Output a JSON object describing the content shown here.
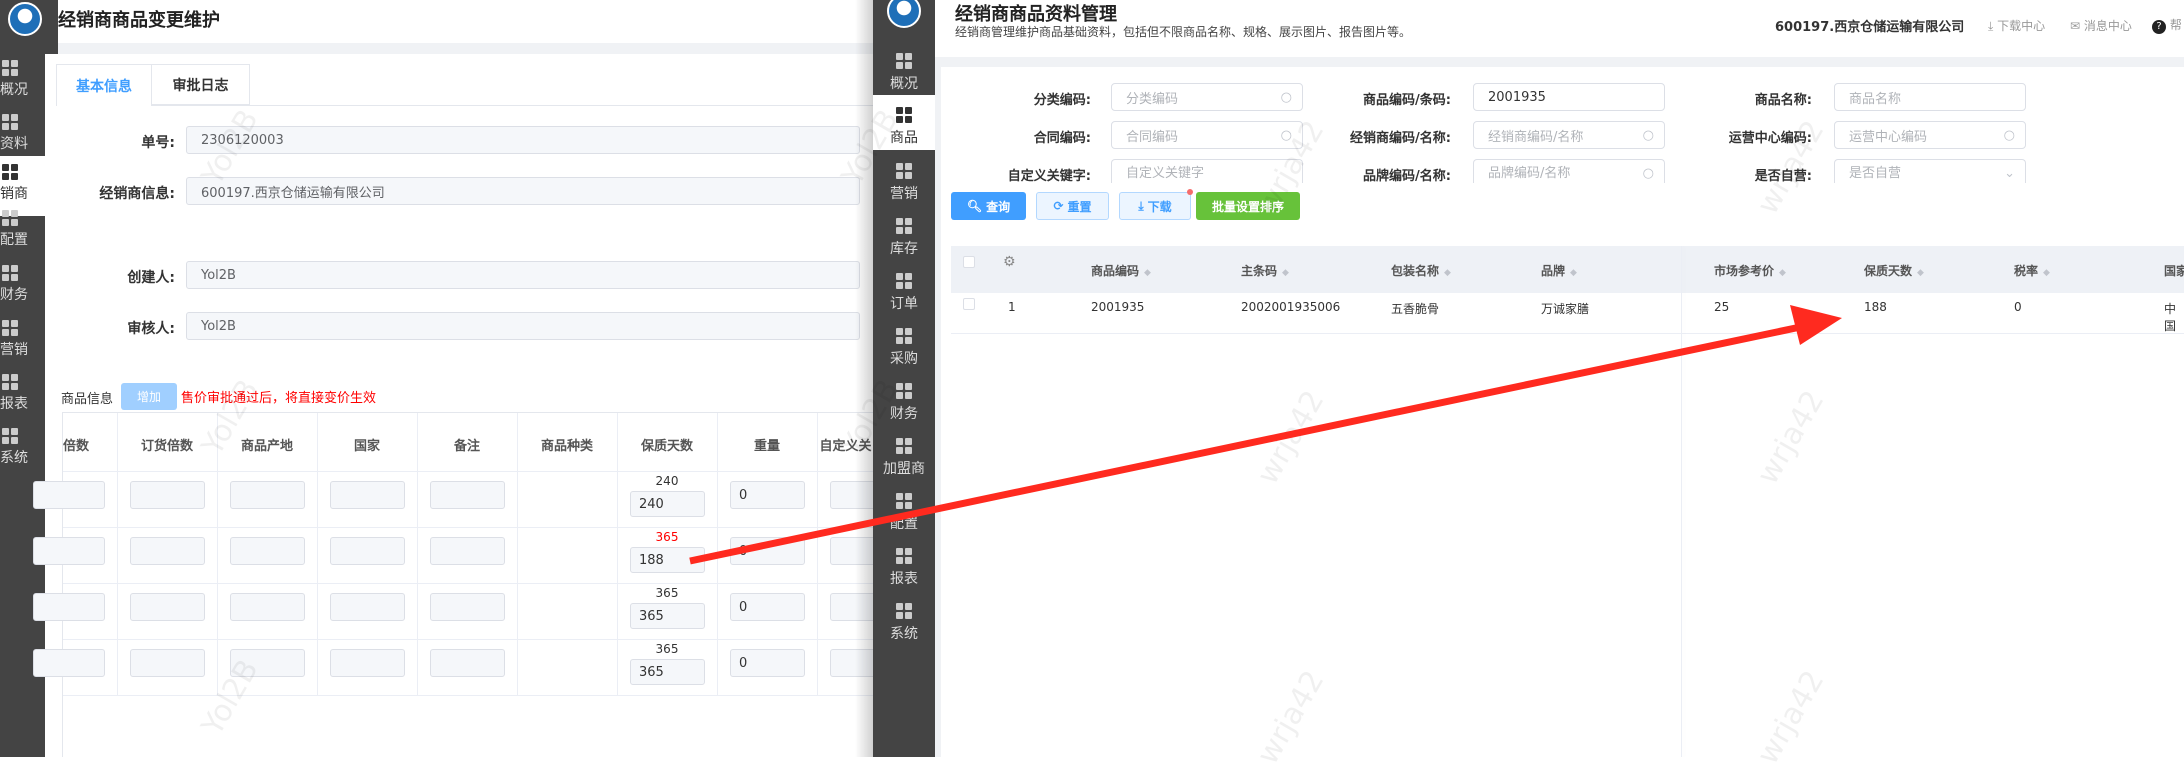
{
  "left": {
    "title": "经销商商品变更维护",
    "sidebar": [
      {
        "label": "概况"
      },
      {
        "label": "资料"
      },
      {
        "label": "销商",
        "active": true
      },
      {
        "label": "配置"
      },
      {
        "label": "财务"
      },
      {
        "label": "营销"
      },
      {
        "label": "报表"
      },
      {
        "label": "系统"
      }
    ],
    "tabs": [
      {
        "label": "基本信息",
        "active": true
      },
      {
        "label": "审批日志"
      }
    ],
    "fields": [
      {
        "label": "单号:",
        "value": "2306120003"
      },
      {
        "label": "经销商信息:",
        "value": "600197.西京仓储运输有限公司"
      },
      {
        "label": "创建人:",
        "value": "Yol2B"
      },
      {
        "label": "审核人:",
        "value": "Yol2B"
      }
    ],
    "goods_label": "商品信息",
    "add_button": "增加",
    "notice": "售价审批通过后，将直接变价生效",
    "columns": [
      "倍数",
      "订货倍数",
      "商品产地",
      "国家",
      "备注",
      "商品种类",
      "保质天数",
      "重量",
      "自定义关"
    ],
    "rows": [
      {
        "shelf_old": "240",
        "shelf_new": "240",
        "weight": "0",
        "changed": false
      },
      {
        "shelf_old": "365",
        "shelf_new": "188",
        "weight": "0",
        "changed": true
      },
      {
        "shelf_old": "365",
        "shelf_new": "365",
        "weight": "0",
        "changed": false
      },
      {
        "shelf_old": "365",
        "shelf_new": "365",
        "weight": "0",
        "changed": false
      }
    ],
    "watermark": "Yol2B"
  },
  "right": {
    "title": "经销商商品资料管理",
    "subtitle": "经销商管理维护商品基础资料，包括但不限商品名称、规格、展示图片、报告图片等。",
    "company": "600197.西京仓储运输有限公司",
    "header_links": [
      "下载中心",
      "消息中心",
      "帮"
    ],
    "sidebar": [
      {
        "label": "概况"
      },
      {
        "label": "商品",
        "active": true
      },
      {
        "label": "营销"
      },
      {
        "label": "库存"
      },
      {
        "label": "订单"
      },
      {
        "label": "采购"
      },
      {
        "label": "财务"
      },
      {
        "label": "加盟商"
      },
      {
        "label": "配置"
      },
      {
        "label": "报表"
      },
      {
        "label": "系统"
      }
    ],
    "filters": [
      {
        "label": "分类编码:",
        "value": "",
        "placeholder": "分类编码",
        "icon": "search"
      },
      {
        "label": "商品编码/条码:",
        "value": "2001935",
        "placeholder": "",
        "icon": ""
      },
      {
        "label": "商品名称:",
        "value": "",
        "placeholder": "商品名称",
        "icon": ""
      },
      {
        "label": "合同编码:",
        "value": "",
        "placeholder": "合同编码",
        "icon": "search"
      },
      {
        "label": "经销商编码/名称:",
        "value": "",
        "placeholder": "经销商编码/名称",
        "icon": "search"
      },
      {
        "label": "运营中心编码:",
        "value": "",
        "placeholder": "运营中心编码",
        "icon": "search"
      },
      {
        "label": "自定义关键字:",
        "value": "",
        "placeholder": "自定义关键字",
        "icon": ""
      },
      {
        "label": "品牌编码/名称:",
        "value": "",
        "placeholder": "品牌编码/名称",
        "icon": "search"
      },
      {
        "label": "是否自营:",
        "value": "",
        "placeholder": "是否自营",
        "icon": "chevron"
      }
    ],
    "buttons": {
      "query": "查询",
      "reset": "重置",
      "download": "下载",
      "batch_sort": "批量设置排序"
    },
    "columns": [
      "商品编码",
      "主条码",
      "包装名称",
      "品牌",
      "市场参考价",
      "保质天数",
      "税率",
      "国家"
    ],
    "rows": [
      {
        "index": "1",
        "code": "2001935",
        "barcode": "2002001935006",
        "package": "五香脆骨",
        "brand": "万诚家膳",
        "market_price": "25",
        "shelf_days": "188",
        "tax": "0",
        "country": "中国"
      }
    ],
    "watermark": "wrja42"
  },
  "colors": {
    "accent": "#409eff",
    "green": "#67c23a",
    "arrow": "#ff2a1f",
    "sidebar": "#444444",
    "changed": "#ff0000"
  }
}
